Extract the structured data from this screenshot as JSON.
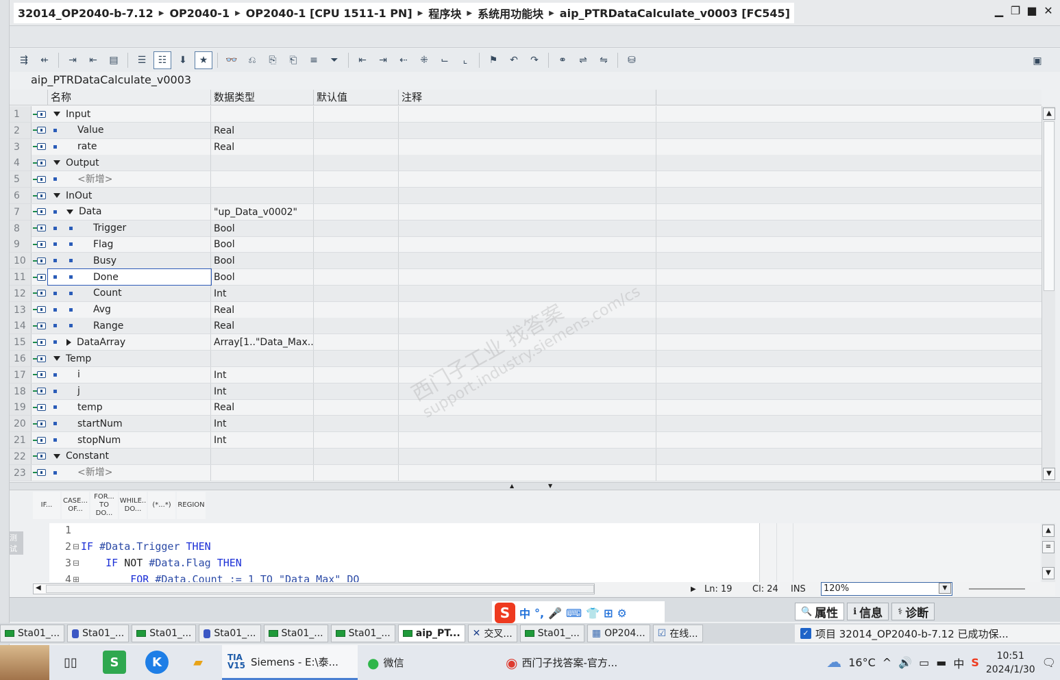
{
  "breadcrumb": [
    "32014_OP2040-b-7.12",
    "OP2040-1",
    "OP2040-1 [CPU 1511-1 PN]",
    "程序块",
    "系统用功能块",
    "aip_PTRDataCalculate_v0003 [FC545]"
  ],
  "block_name": "aip_PTRDataCalculate_v0003",
  "table": {
    "headers": {
      "name": "名称",
      "type": "数据类型",
      "default": "默认值",
      "comment": "注释"
    },
    "rows": [
      {
        "num": "1",
        "name": "Input",
        "type": "",
        "level": 0,
        "kind": "section"
      },
      {
        "num": "2",
        "name": "Value",
        "type": "Real",
        "level": 1,
        "kind": "var"
      },
      {
        "num": "3",
        "name": "rate",
        "type": "Real",
        "level": 1,
        "kind": "var"
      },
      {
        "num": "4",
        "name": "Output",
        "type": "",
        "level": 0,
        "kind": "section"
      },
      {
        "num": "5",
        "name": "<新增>",
        "type": "",
        "level": 1,
        "kind": "add"
      },
      {
        "num": "6",
        "name": "InOut",
        "type": "",
        "level": 0,
        "kind": "section"
      },
      {
        "num": "7",
        "name": "Data",
        "type": "\"up_Data_v0002\"",
        "level": 1,
        "kind": "struct-open"
      },
      {
        "num": "8",
        "name": "Trigger",
        "type": "Bool",
        "level": 2,
        "kind": "var"
      },
      {
        "num": "9",
        "name": "Flag",
        "type": "Bool",
        "level": 2,
        "kind": "var"
      },
      {
        "num": "10",
        "name": "Busy",
        "type": "Bool",
        "level": 2,
        "kind": "var"
      },
      {
        "num": "11",
        "name": "Done",
        "type": "Bool",
        "level": 2,
        "kind": "var",
        "selected": true
      },
      {
        "num": "12",
        "name": "Count",
        "type": "Int",
        "level": 2,
        "kind": "var"
      },
      {
        "num": "13",
        "name": "Avg",
        "type": "Real",
        "level": 2,
        "kind": "var"
      },
      {
        "num": "14",
        "name": "Range",
        "type": "Real",
        "level": 2,
        "kind": "var"
      },
      {
        "num": "15",
        "name": "DataArray",
        "type": "Array[1..\"Data_Max...",
        "level": 1,
        "kind": "struct-closed"
      },
      {
        "num": "16",
        "name": "Temp",
        "type": "",
        "level": 0,
        "kind": "section"
      },
      {
        "num": "17",
        "name": "i",
        "type": "Int",
        "level": 1,
        "kind": "var"
      },
      {
        "num": "18",
        "name": "j",
        "type": "Int",
        "level": 1,
        "kind": "var"
      },
      {
        "num": "19",
        "name": "temp",
        "type": "Real",
        "level": 1,
        "kind": "var"
      },
      {
        "num": "20",
        "name": "startNum",
        "type": "Int",
        "level": 1,
        "kind": "var"
      },
      {
        "num": "21",
        "name": "stopNum",
        "type": "Int",
        "level": 1,
        "kind": "var"
      },
      {
        "num": "22",
        "name": "Constant",
        "type": "",
        "level": 0,
        "kind": "section"
      },
      {
        "num": "23",
        "name": "<新增>",
        "type": "",
        "level": 1,
        "kind": "add"
      }
    ]
  },
  "scl_buttons": [
    {
      "label": "IF..."
    },
    {
      "label": "CASE... OF..."
    },
    {
      "label": "FOR... TO DO..."
    },
    {
      "label": "WHILE.. DO..."
    },
    {
      "label": "(*...*)"
    },
    {
      "label": "REGION"
    }
  ],
  "side_label": "测试",
  "code_lines": [
    {
      "num": "1",
      "fold": "",
      "indent": "",
      "tokens": []
    },
    {
      "num": "2",
      "fold": "⊟",
      "indent": "",
      "tokens": [
        {
          "t": "IF",
          "c": "kw"
        },
        {
          "t": " #Data.Trigger ",
          "c": "var"
        },
        {
          "t": "THEN",
          "c": "kw"
        }
      ]
    },
    {
      "num": "3",
      "fold": "⊟",
      "indent": "    ",
      "tokens": [
        {
          "t": "IF ",
          "c": "kw"
        },
        {
          "t": "NOT ",
          "c": ""
        },
        {
          "t": "#Data.Flag ",
          "c": "var"
        },
        {
          "t": "THEN",
          "c": "kw"
        }
      ]
    },
    {
      "num": "4",
      "fold": "⊞",
      "indent": "        ",
      "tokens": [
        {
          "t": "FOR ",
          "c": "kw"
        },
        {
          "t": "#Data.Count := 1 TO \"Data_Max\" DO",
          "c": "var"
        }
      ]
    }
  ],
  "editor_status": {
    "ln": "Ln: 19",
    "cl": "Cl: 24",
    "ins": "INS",
    "zoom": "120%"
  },
  "inspector_tabs": [
    "属性",
    "信息",
    "诊断"
  ],
  "editor_tabs": [
    "Sta01_...",
    "Sta01_...",
    "Sta01_...",
    "Sta01_...",
    "Sta01_...",
    "Sta01_...",
    "aip_PT...",
    "交叉...",
    "Sta01_...",
    "OP204...",
    "在线..."
  ],
  "status_message": "项目 32014_OP2040-b-7.12 已成功保...",
  "taskbar": {
    "apps": [
      {
        "label": "Siemens  -  E:\\泰..."
      },
      {
        "label": "微信"
      },
      {
        "label": "西门子找答案-官方..."
      }
    ],
    "weather": "16°C",
    "tray_ime": "中",
    "time": "10:51",
    "date": "2024/1/30",
    "tia_logo": "TIA V15"
  },
  "watermark": {
    "line1": "西门子工业  找答案",
    "line2": "support.industry.siemens.com/cs"
  }
}
